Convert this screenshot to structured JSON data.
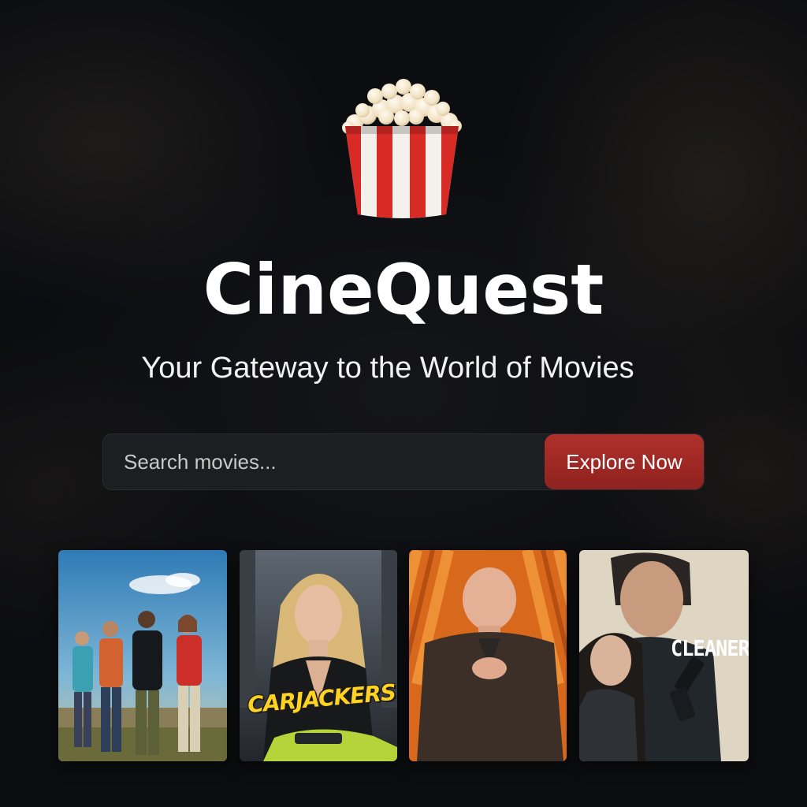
{
  "brand": {
    "logo_icon": "popcorn-bucket-icon",
    "title": "CineQuest",
    "tagline": "Your Gateway to the World of Movies"
  },
  "search": {
    "placeholder": "Search movies...",
    "value": "",
    "button_label": "Explore Now"
  },
  "posters": [
    {
      "title": ""
    },
    {
      "title": "CARJACKERS"
    },
    {
      "title": ""
    },
    {
      "title": "CLEANER"
    }
  ],
  "colors": {
    "background": "#0c0d10",
    "accent": "#a12a26",
    "search_bg": "#1d1e22",
    "title_text": "#ffffff",
    "carjackers_yellow": "#ffd31f"
  }
}
